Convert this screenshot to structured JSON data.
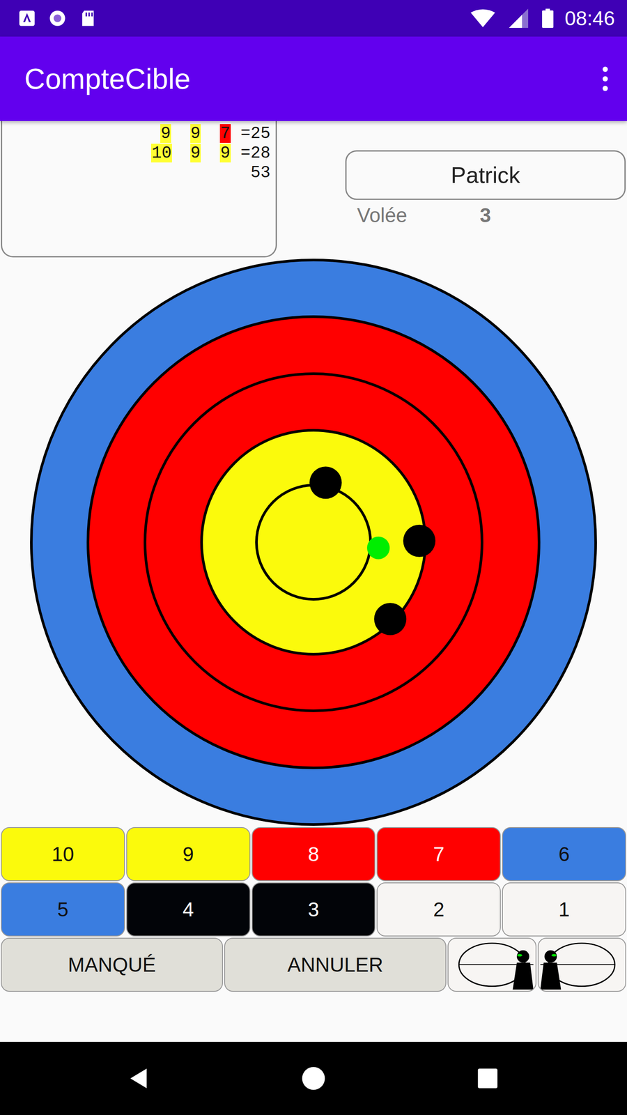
{
  "status_bar": {
    "time": "08:46"
  },
  "app_bar": {
    "title": "CompteCible"
  },
  "score_sheet": {
    "ends": [
      {
        "scores": [
          {
            "value": "9",
            "color": "#ffff33"
          },
          {
            "value": "9",
            "color": "#ffff33"
          },
          {
            "value": "7",
            "color": "#ff0000"
          }
        ],
        "equals": "=",
        "total": "25"
      },
      {
        "scores": [
          {
            "value": "10",
            "color": "#ffff33"
          },
          {
            "value": "9",
            "color": "#ffff33"
          },
          {
            "value": "9",
            "color": "#ffff33"
          }
        ],
        "equals": "=",
        "total": "28"
      }
    ],
    "grand_total": "53"
  },
  "player": {
    "name": "Patrick",
    "end_label": "Volée",
    "end_number": "3"
  },
  "target": {
    "marks": [
      {
        "kind": "arrow",
        "x": 0.043,
        "y": -0.211
      },
      {
        "kind": "arrow",
        "x": 0.375,
        "y": -0.005
      },
      {
        "kind": "arrow",
        "x": 0.272,
        "y": 0.272
      },
      {
        "kind": "cursor",
        "x": 0.23,
        "y": 0.02
      }
    ]
  },
  "score_buttons": [
    {
      "label": "10",
      "color": "#fbfa0c"
    },
    {
      "label": "9",
      "color": "#fbfa0c"
    },
    {
      "label": "8",
      "color": "#ff0000"
    },
    {
      "label": "7",
      "color": "#ff0000"
    },
    {
      "label": "6",
      "color": "#3a7de0"
    },
    {
      "label": "5",
      "color": "#3a7de0"
    },
    {
      "label": "4",
      "color": "#020408"
    },
    {
      "label": "3",
      "color": "#020408"
    },
    {
      "label": "2",
      "color": "#f7f5f3"
    },
    {
      "label": "1",
      "color": "#f7f5f3"
    }
  ],
  "actions": [
    "MANQUÉ",
    "ANNULER"
  ]
}
